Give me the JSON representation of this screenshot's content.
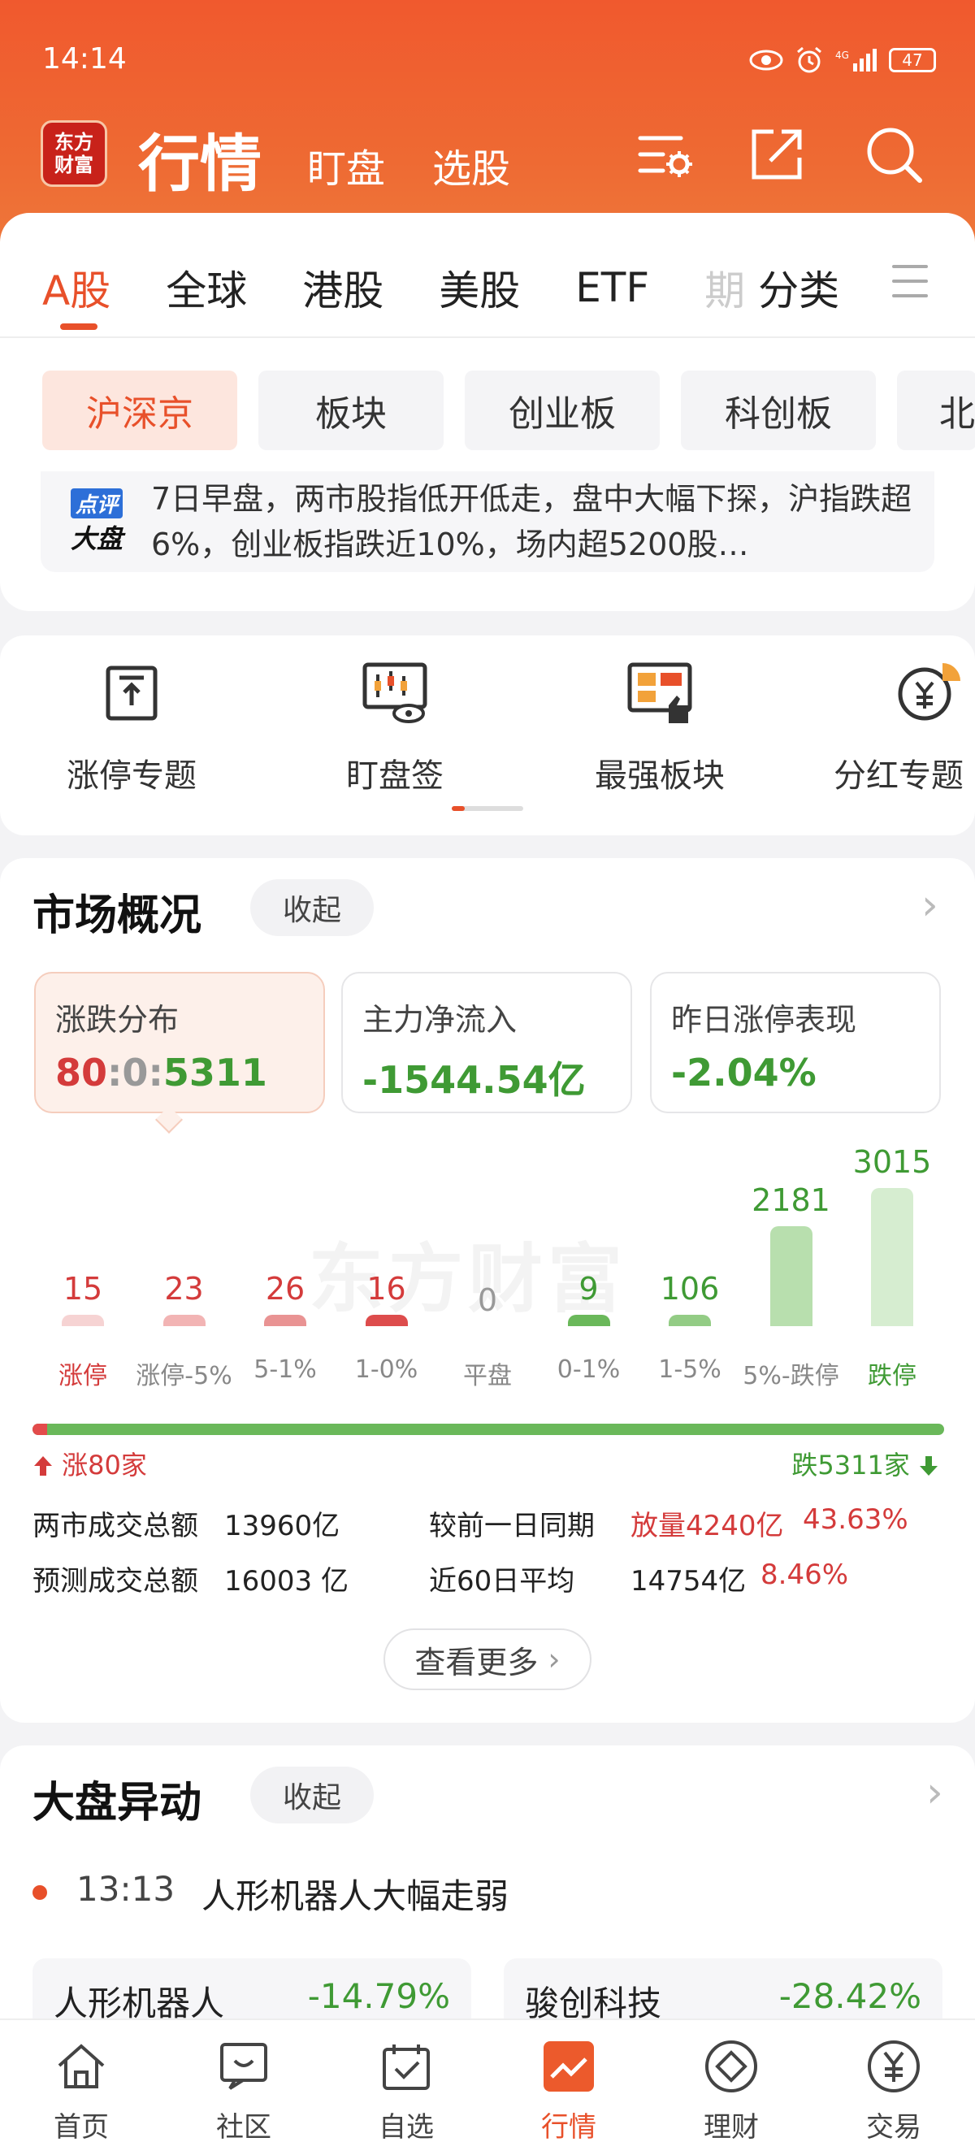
{
  "status_bar": {
    "time": "14:14",
    "battery": "47"
  },
  "header": {
    "logo_text": "东方财富",
    "title": "行情",
    "links": [
      "盯盘",
      "选股"
    ]
  },
  "market_tabs": [
    {
      "label": "A股",
      "active": true
    },
    {
      "label": "全球"
    },
    {
      "label": "港股"
    },
    {
      "label": "美股"
    },
    {
      "label": "ETF"
    },
    {
      "label": "期",
      "faded": true
    },
    {
      "label": "分类"
    }
  ],
  "chips": [
    {
      "label": "沪深京",
      "active": true
    },
    {
      "label": "板块"
    },
    {
      "label": "创业板"
    },
    {
      "label": "科创板"
    },
    {
      "label": "北"
    }
  ],
  "news": {
    "badge_top": "点评",
    "badge_bottom": "大盘",
    "text": "7日早盘，两市股指低开低走，盘中大幅下探，沪指跌超6%，创业板指跌近10%，场内超5200股…"
  },
  "shortcuts": [
    {
      "label": "涨停专题",
      "icon": "limit-up-topic-icon"
    },
    {
      "label": "盯盘签",
      "icon": "watch-sign-icon"
    },
    {
      "label": "最强板块",
      "icon": "strongest-sector-icon"
    },
    {
      "label": "分红专题",
      "icon": "dividend-topic-icon"
    }
  ],
  "market_overview": {
    "title": "市场概况",
    "collapse_label": "收起",
    "stats": [
      {
        "title": "涨跌分布",
        "up": "80",
        "flat": "0",
        "down": "5311",
        "sep": ":"
      },
      {
        "title": "主力净流入",
        "value": "-1544.54亿"
      },
      {
        "title": "昨日涨停表现",
        "value": "-2.04%"
      }
    ],
    "watermark": "东方财富",
    "ratio": {
      "up_label": "涨80家",
      "down_label": "跌5311家",
      "up": 80,
      "down": 5311
    },
    "info": {
      "total_turnover_label": "两市成交总额",
      "total_turnover": "13960亿",
      "compare_label": "较前一日同期",
      "compare_value": "放量4240亿",
      "compare_pct": "43.63%",
      "forecast_label": "预测成交总额",
      "forecast": "16003 亿",
      "avg60_label": "近60日平均",
      "avg60": "14754亿",
      "avg60_pct": "8.46%"
    },
    "more_label": "查看更多",
    "colors": {
      "up": "#d43b3b",
      "down": "#3f9a34",
      "flat": "#999999"
    }
  },
  "chart_data": {
    "type": "bar",
    "categories": [
      "涨停",
      "涨停-5%",
      "5-1%",
      "1-0%",
      "平盘",
      "0-1%",
      "1-5%",
      "5%-跌停",
      "跌停"
    ],
    "values": [
      15,
      23,
      26,
      16,
      0,
      9,
      106,
      2181,
      3015
    ],
    "bar_colors": [
      "#f6d3d3",
      "#f2b4b4",
      "#e99393",
      "#dd4c4c",
      "#cccccc",
      "#6ab85a",
      "#93cc85",
      "#b8dfae",
      "#d6edd0"
    ],
    "label_colors": [
      "#d43b3b",
      "#888888",
      "#888888",
      "#888888",
      "#888888",
      "#888888",
      "#888888",
      "#888888",
      "#3f9a34"
    ],
    "value_colors": [
      "#d43b3b",
      "#d43b3b",
      "#d43b3b",
      "#d43b3b",
      "#999999",
      "#3f9a34",
      "#3f9a34",
      "#3f9a34",
      "#3f9a34"
    ],
    "title": "",
    "xlabel": "",
    "ylabel": "",
    "ylim": [
      0,
      3015
    ],
    "grid": false
  },
  "dapan": {
    "title": "大盘异动",
    "collapse_label": "收起",
    "event_time": "13:13",
    "event_text": "人形机器人大幅走弱",
    "stocks": [
      {
        "name": "人形机器人",
        "pct": "-14.79%"
      },
      {
        "name": "骏创科技",
        "pct": "-28.42%"
      }
    ]
  },
  "bottom_nav": [
    {
      "label": "首页",
      "icon": "home-icon"
    },
    {
      "label": "社区",
      "icon": "community-icon"
    },
    {
      "label": "自选",
      "icon": "watchlist-icon"
    },
    {
      "label": "行情",
      "icon": "market-icon",
      "active": true
    },
    {
      "label": "理财",
      "icon": "wealth-icon"
    },
    {
      "label": "交易",
      "icon": "trade-icon"
    }
  ]
}
